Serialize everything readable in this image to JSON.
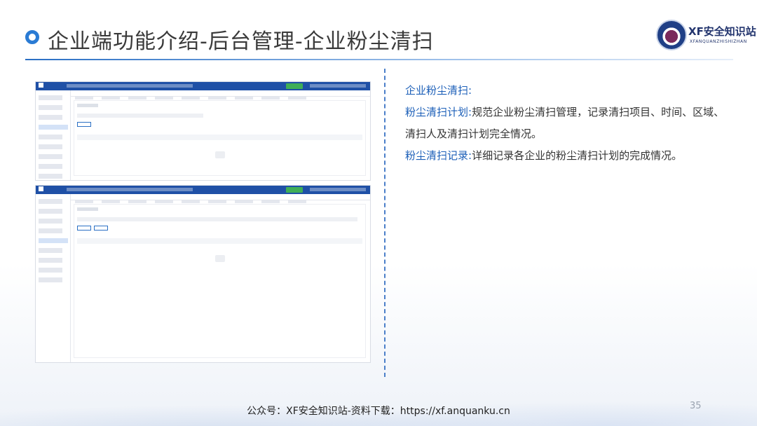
{
  "slide": {
    "title": "企业端功能介绍-后台管理-企业粉尘清扫",
    "page_number": "35",
    "footer": "公众号：XF安全知识站-资料下载：https://xf.anquanku.cn"
  },
  "logo": {
    "name": "XF安全知识站",
    "subtitle": "XFANQUANZHISHIZHAN"
  },
  "description": {
    "heading": "企业粉尘清扫:",
    "items": [
      {
        "label": "粉尘清扫计划:",
        "text": "规范企业粉尘清扫管理，记录清扫项目、时间、区域、清扫人及清扫计划完全情况。"
      },
      {
        "label": "粉尘清扫记录:",
        "text": "详细记录各企业的粉尘清扫计划的完成情况。"
      }
    ]
  },
  "colors": {
    "accent": "#1c5fb8",
    "header_bar": "#1f50a6",
    "title_line": "#2a6fc4"
  }
}
